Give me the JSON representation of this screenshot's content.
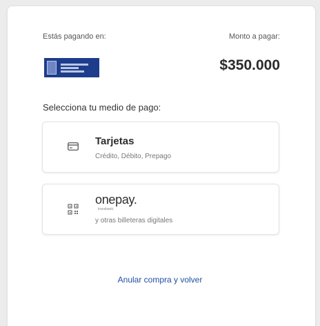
{
  "merchant": {
    "paying_label": "Estás pagando en:",
    "logo_icon": "merchant-logo"
  },
  "amount": {
    "label": "Monto a pagar:",
    "value": "$350.000"
  },
  "payment": {
    "section_title": "Selecciona tu medio de pago:",
    "options": [
      {
        "title": "Tarjetas",
        "subtitle": "Crédito, Débito, Prepago",
        "icon": "card-icon"
      },
      {
        "title": "onepay.",
        "brand_sub": "transbank.",
        "subtitle": "y otras billeteras digitales",
        "icon": "qr-code-icon"
      }
    ]
  },
  "actions": {
    "cancel_label": "Anular compra y volver"
  },
  "colors": {
    "link": "#1f4fa0",
    "merchant_logo_bg": "#1e3c8c",
    "background": "#ececec",
    "card": "#ffffff"
  }
}
